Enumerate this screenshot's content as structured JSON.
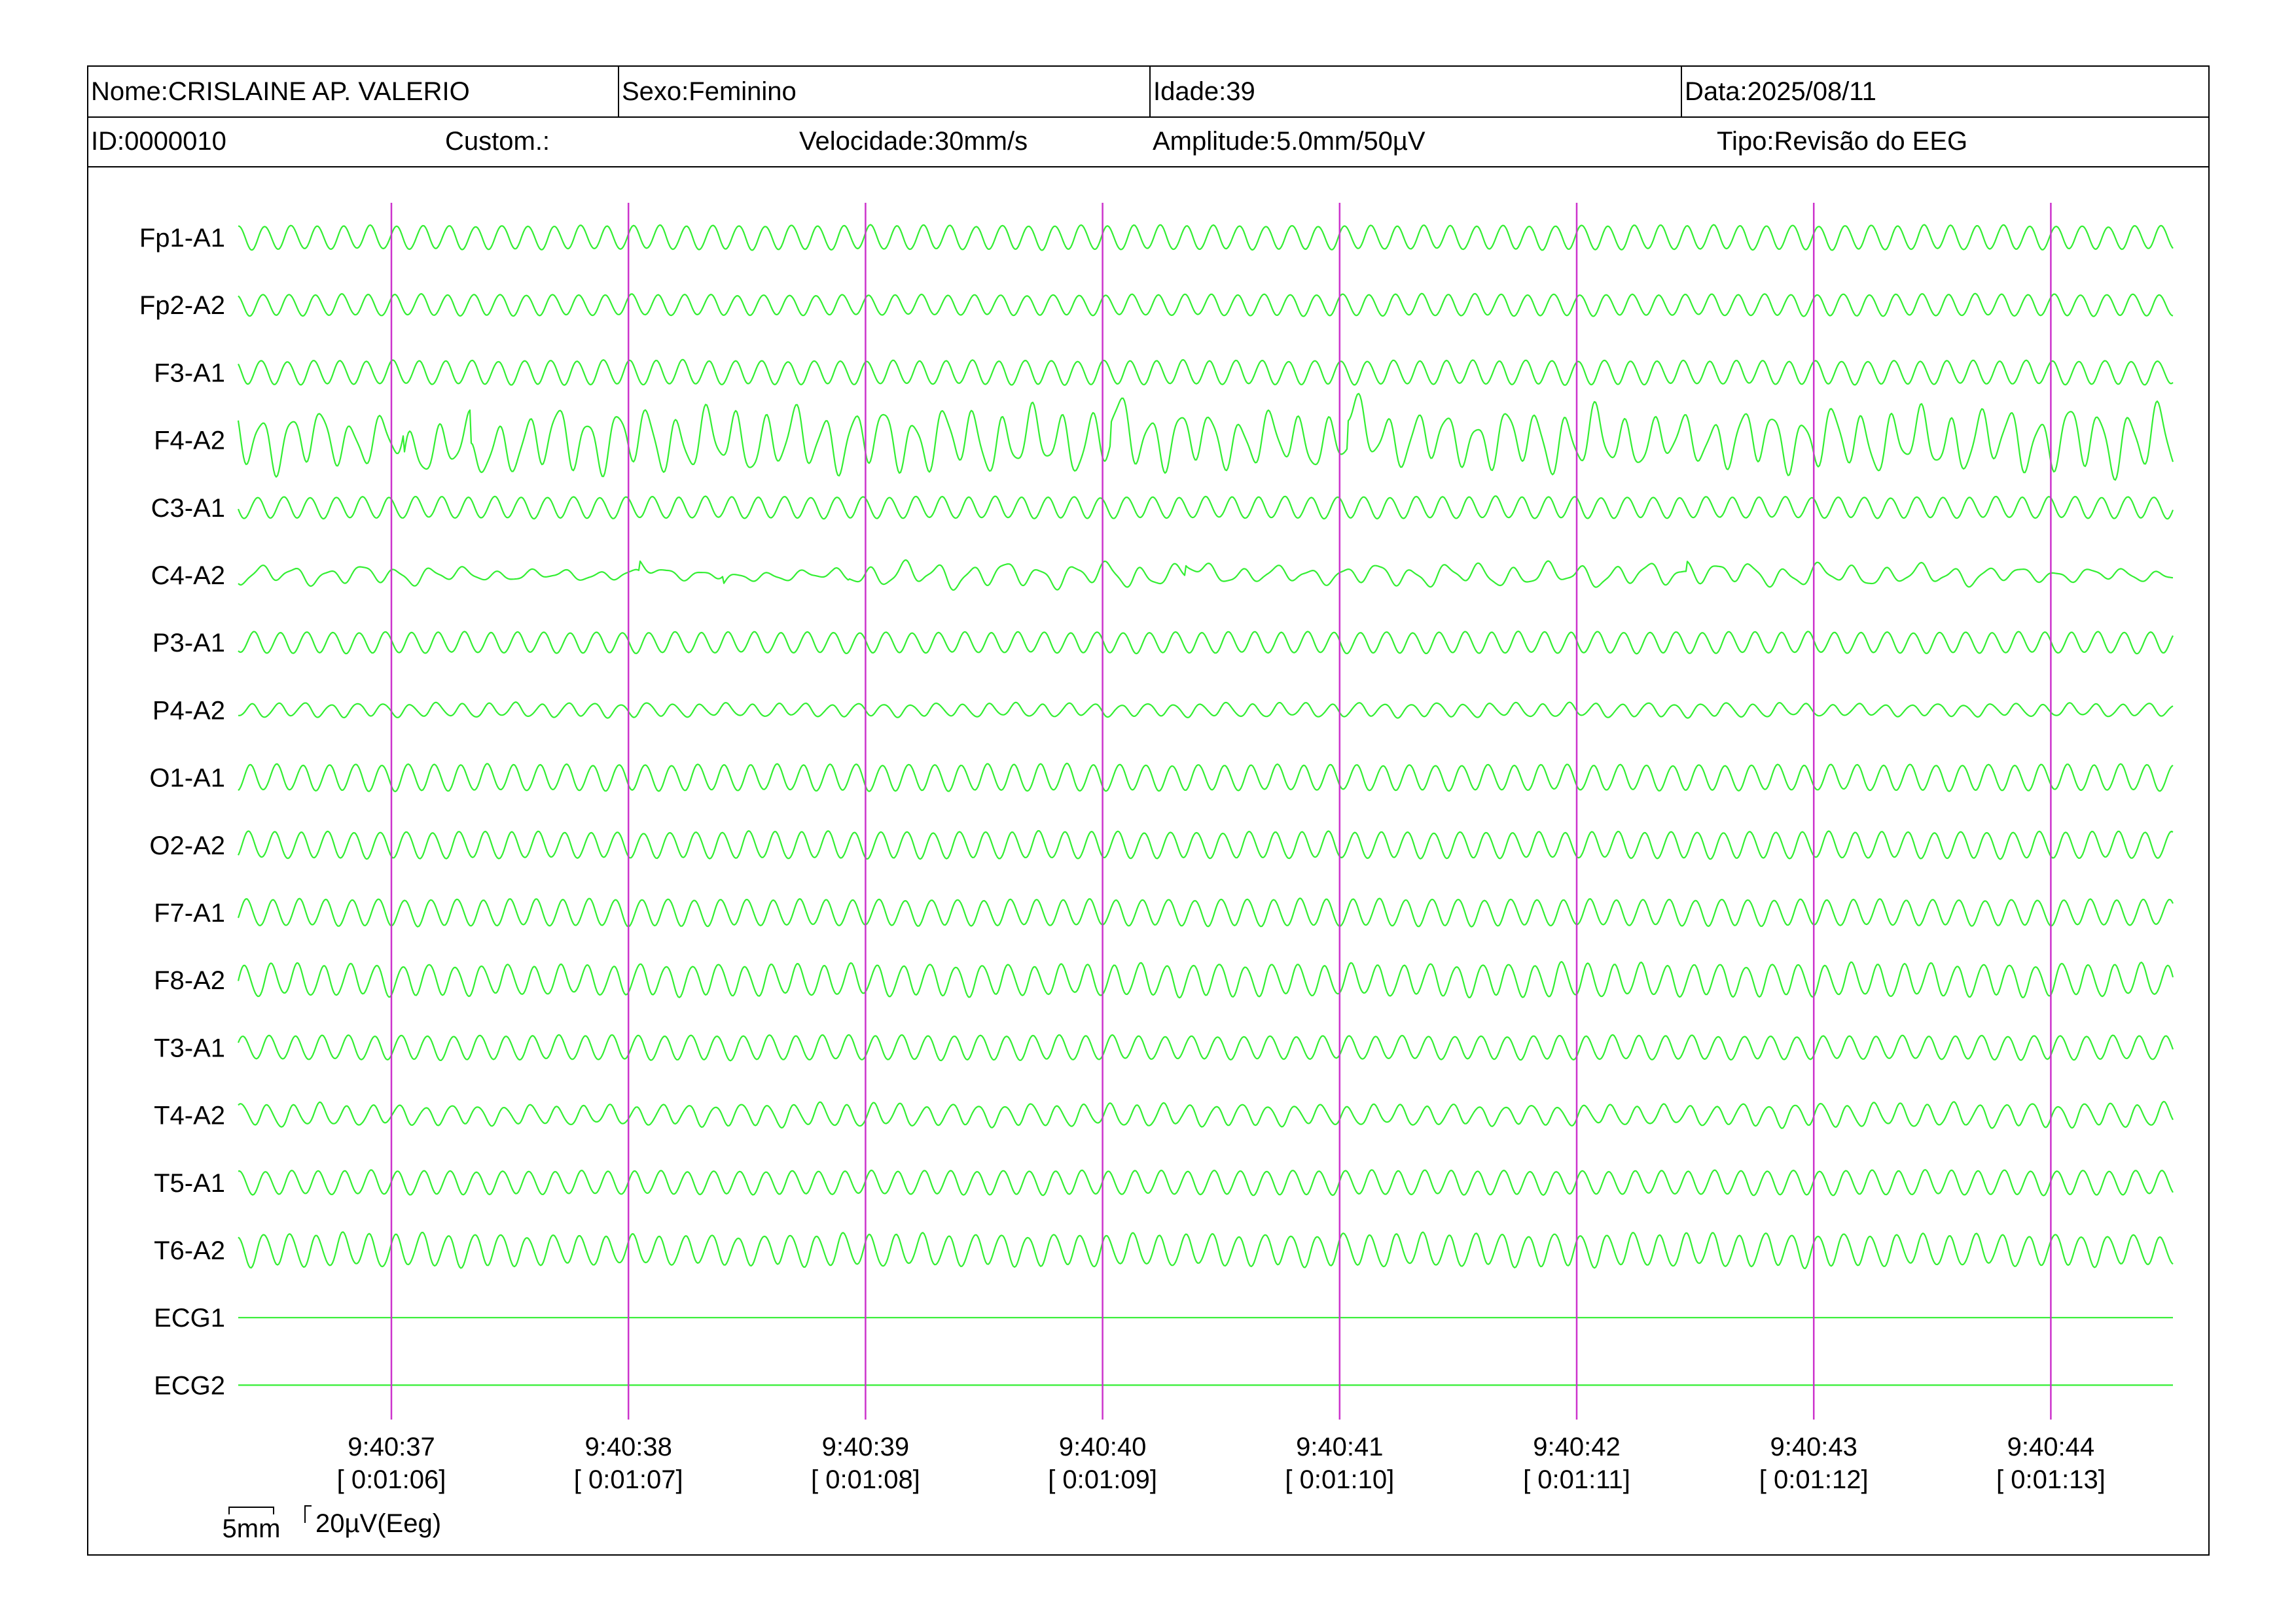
{
  "header": {
    "name": "Nome:CRISLAINE AP. VALERIO",
    "sex": "Sexo:Feminino",
    "age": "Idade:39",
    "date": "Data:2025/08/11",
    "id": "ID:0000010",
    "custom": "Custom.:",
    "speed": "Velocidade:30mm/s",
    "amplitude": "Amplitude:5.0mm/50µV",
    "type": "Tipo:Revisão do EEG"
  },
  "chart_data": {
    "type": "line",
    "title": "",
    "xlabel": "",
    "ylabel": "",
    "trace_color": "#33ee33",
    "marker_color": "#cc33cc",
    "channels": [
      {
        "label": "Fp1-A1",
        "kind": "eeg",
        "amp": 0.9,
        "freq": 9.0,
        "irregular": 0.1
      },
      {
        "label": "Fp2-A2",
        "kind": "eeg",
        "amp": 0.8,
        "freq": 9.0,
        "irregular": 0.1
      },
      {
        "label": "F3-A1",
        "kind": "eeg",
        "amp": 0.9,
        "freq": 9.0,
        "irregular": 0.1
      },
      {
        "label": "F4-A2",
        "kind": "eeg",
        "amp": 1.9,
        "freq": 8.0,
        "irregular": 0.6
      },
      {
        "label": "C3-A1",
        "kind": "eeg",
        "amp": 0.8,
        "freq": 9.0,
        "irregular": 0.1
      },
      {
        "label": "C4-A2",
        "kind": "eeg",
        "amp": 0.6,
        "freq": 7.0,
        "irregular": 0.8
      },
      {
        "label": "P3-A1",
        "kind": "eeg",
        "amp": 0.8,
        "freq": 9.0,
        "irregular": 0.1
      },
      {
        "label": "P4-A2",
        "kind": "eeg",
        "amp": 0.5,
        "freq": 9.0,
        "irregular": 0.3
      },
      {
        "label": "O1-A1",
        "kind": "eeg",
        "amp": 1.0,
        "freq": 9.0,
        "irregular": 0.1
      },
      {
        "label": "O2-A2",
        "kind": "eeg",
        "amp": 1.0,
        "freq": 9.0,
        "irregular": 0.1
      },
      {
        "label": "F7-A1",
        "kind": "eeg",
        "amp": 1.0,
        "freq": 9.0,
        "irregular": 0.1
      },
      {
        "label": "F8-A2",
        "kind": "eeg",
        "amp": 1.2,
        "freq": 9.0,
        "irregular": 0.2
      },
      {
        "label": "T3-A1",
        "kind": "eeg",
        "amp": 0.9,
        "freq": 9.0,
        "irregular": 0.1
      },
      {
        "label": "T4-A2",
        "kind": "eeg",
        "amp": 0.8,
        "freq": 9.0,
        "irregular": 0.3
      },
      {
        "label": "T5-A1",
        "kind": "eeg",
        "amp": 0.9,
        "freq": 9.0,
        "irregular": 0.1
      },
      {
        "label": "T6-A2",
        "kind": "eeg",
        "amp": 1.2,
        "freq": 9.0,
        "irregular": 0.2
      },
      {
        "label": "ECG1",
        "kind": "flat"
      },
      {
        "label": "ECG2",
        "kind": "flat"
      }
    ],
    "time_markers": [
      {
        "time": "9:40:37",
        "elapsed": "[ 0:01:06]"
      },
      {
        "time": "9:40:38",
        "elapsed": "[ 0:01:07]"
      },
      {
        "time": "9:40:39",
        "elapsed": "[ 0:01:08]"
      },
      {
        "time": "9:40:40",
        "elapsed": "[ 0:01:09]"
      },
      {
        "time": "9:40:41",
        "elapsed": "[ 0:01:10]"
      },
      {
        "time": "9:40:42",
        "elapsed": "[ 0:01:11]"
      },
      {
        "time": "9:40:43",
        "elapsed": "[ 0:01:12]"
      },
      {
        "time": "9:40:44",
        "elapsed": "[ 0:01:13]"
      }
    ],
    "scale_bar": {
      "time_label": "5mm",
      "amp_label": "20µV(Eeg)"
    }
  }
}
